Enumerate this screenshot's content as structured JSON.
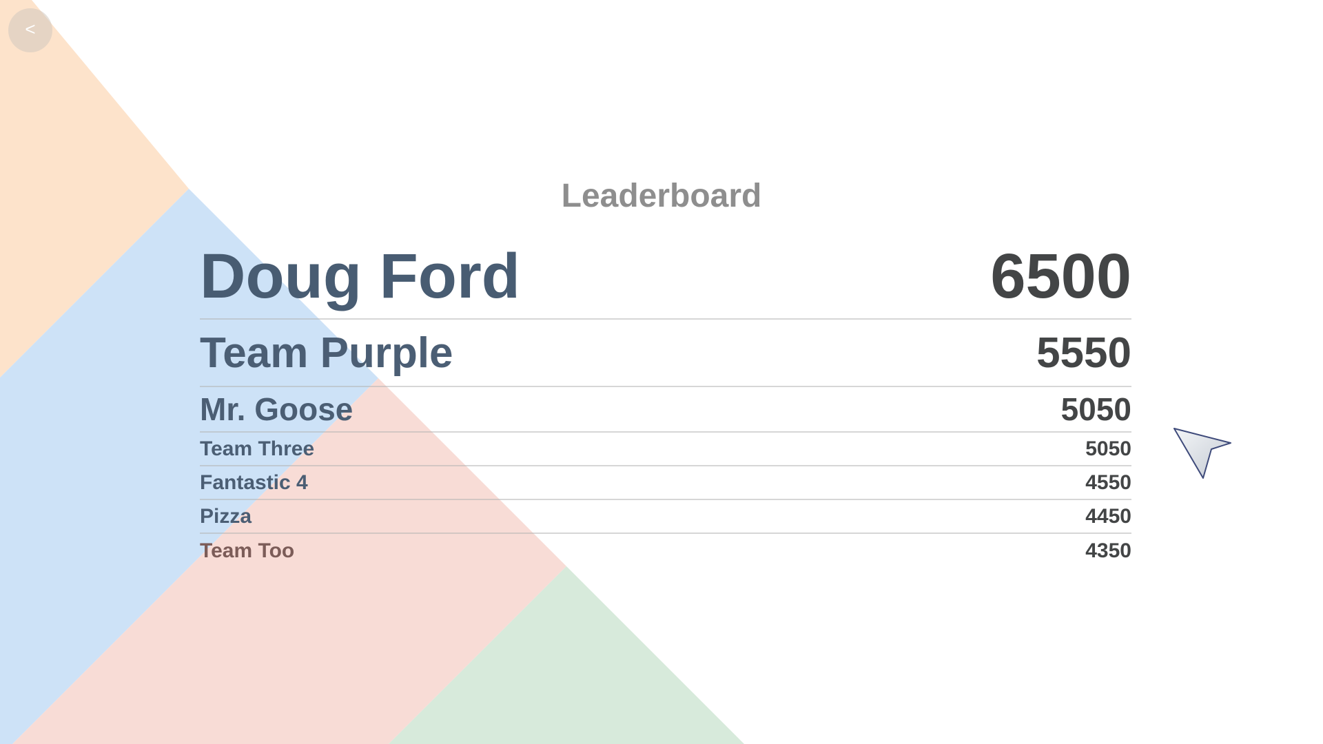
{
  "back": {
    "icon": "chevron-left-icon",
    "glyph": "<"
  },
  "title": "Leaderboard",
  "colors": {
    "peach": "#fde3cb",
    "blue": "#cde2f7",
    "pink": "#f8dcd6",
    "green": "#d7eadb",
    "name_text": "#4b5e74",
    "score_text": "#434546",
    "title_text": "#8e8e8e"
  },
  "leaderboard": [
    {
      "rank": 1,
      "name": "Doug Ford",
      "score": "6500"
    },
    {
      "rank": 2,
      "name": "Team Purple",
      "score": "5550"
    },
    {
      "rank": 3,
      "name": "Mr. Goose",
      "score": "5050"
    },
    {
      "rank": 4,
      "name": "Team Three",
      "score": "5050"
    },
    {
      "rank": 5,
      "name": "Fantastic 4",
      "score": "4550"
    },
    {
      "rank": 6,
      "name": "Pizza",
      "score": "4450"
    },
    {
      "rank": 7,
      "name": "Team Too",
      "score": "4350"
    }
  ],
  "cursor": {
    "icon": "arrow-cursor-icon"
  }
}
